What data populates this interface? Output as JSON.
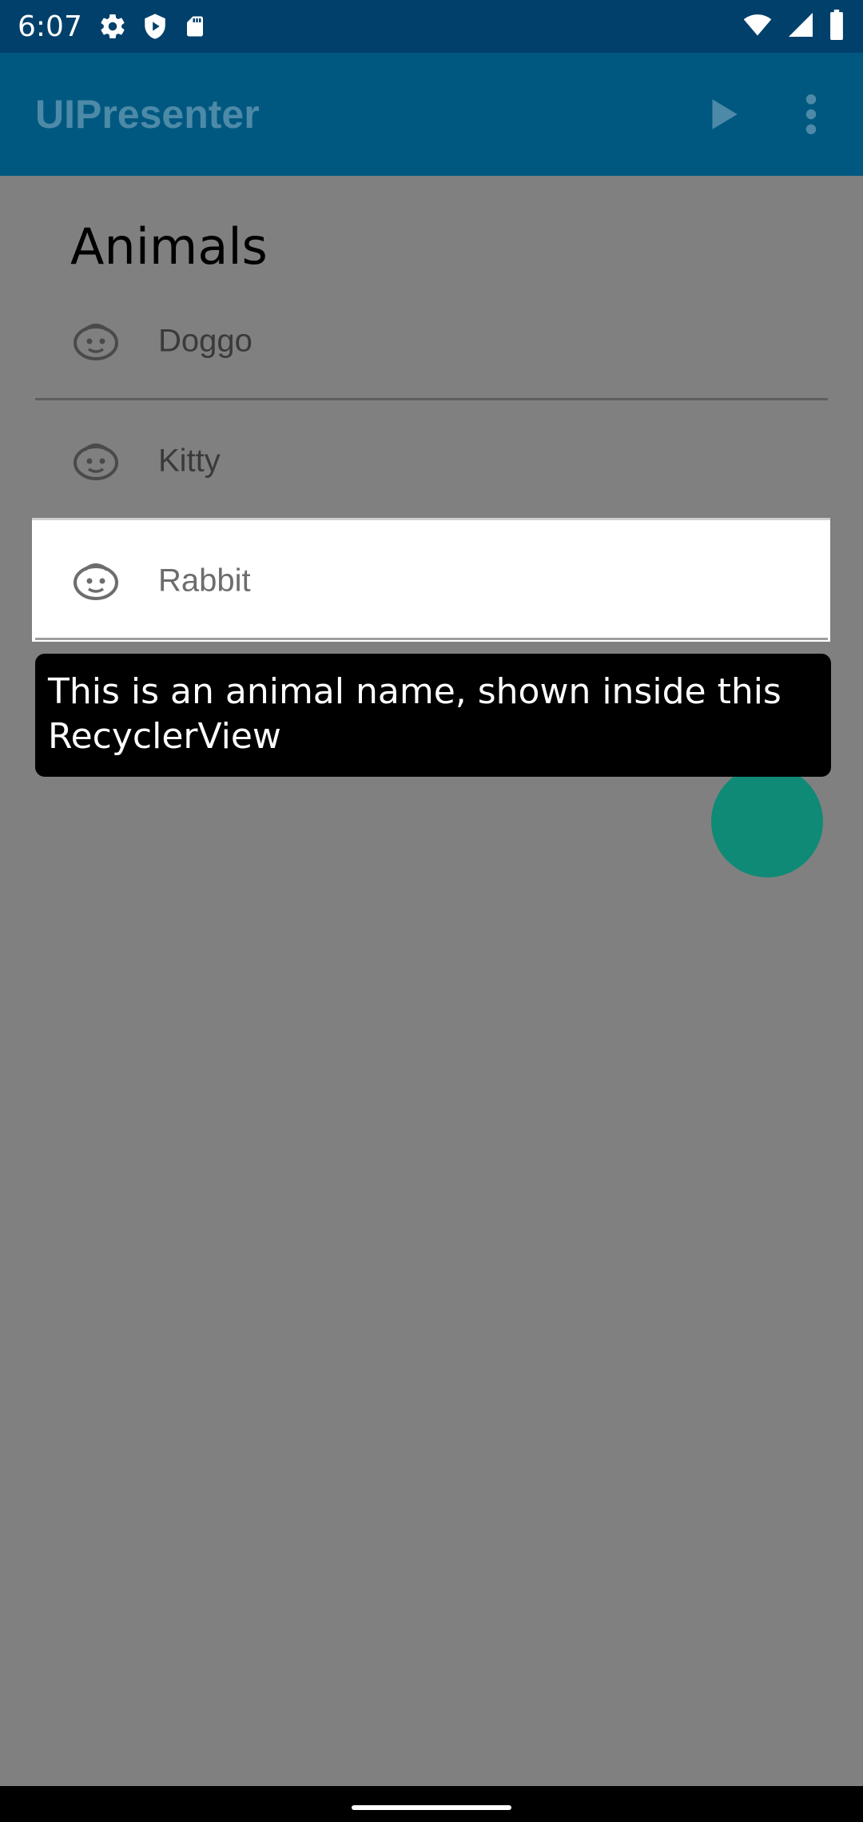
{
  "status_bar": {
    "time": "6:07",
    "left_icons": [
      "gear-icon",
      "shield-icon",
      "sd-card-icon"
    ],
    "right_icons": [
      "wifi-icon",
      "signal-icon",
      "battery-icon"
    ]
  },
  "app_bar": {
    "title": "UIPresenter",
    "actions": [
      "play-icon",
      "more-vert-icon"
    ]
  },
  "content": {
    "section_title": "Animals",
    "items": [
      {
        "label": "Doggo",
        "icon": "face-icon"
      },
      {
        "label": "Kitty",
        "icon": "face-icon"
      },
      {
        "label": "Rabbit",
        "icon": "face-icon"
      }
    ],
    "tooltip": "This is an animal name, shown inside this RecyclerView"
  },
  "colors": {
    "status_bar": "#01406b",
    "app_bar": "#005880",
    "scrim": "#808080",
    "fab": "#0f8a76",
    "tooltip_bg": "#000000"
  }
}
